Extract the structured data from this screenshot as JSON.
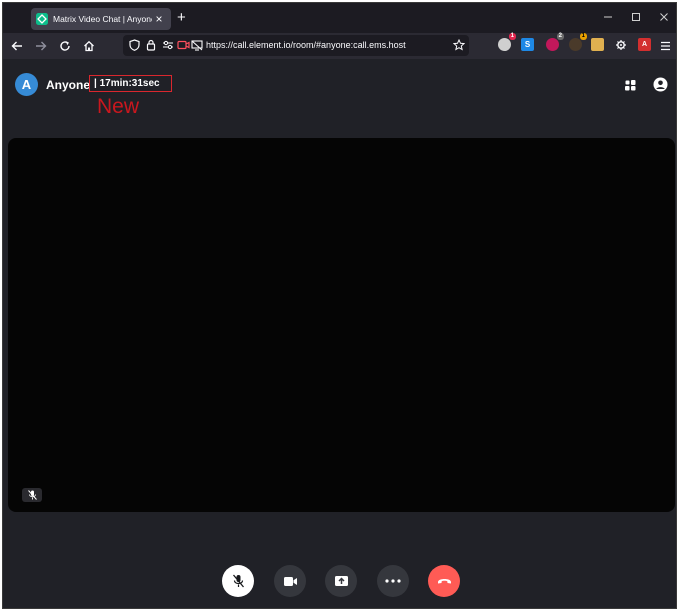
{
  "browser": {
    "tab": {
      "title": "Matrix Video Chat | Anyone",
      "favicon": "matrix-logo-icon"
    },
    "url": "https://call.element.io/room/#anyone:call.ems.host",
    "extensions": [
      {
        "name": "extension-1-icon",
        "badge": "1",
        "color": "#cfcfcf",
        "badge_color": "#e22850"
      },
      {
        "name": "skype-extension-icon",
        "badge": "",
        "color": "#1e88e5",
        "badge_color": ""
      },
      {
        "name": "extension-3-icon",
        "badge": "2",
        "color": "#c2185b",
        "badge_color": "#6b6b6b"
      },
      {
        "name": "extension-4-icon",
        "badge": "1",
        "color": "#4a3a2a",
        "badge_color": "#e8a000"
      },
      {
        "name": "extension-5-icon",
        "badge": "",
        "color": "#e0b050",
        "badge_color": ""
      },
      {
        "name": "puzzle-extension-icon",
        "badge": "",
        "color": "#cfcfcf",
        "badge_color": ""
      },
      {
        "name": "pdf-extension-icon",
        "badge": "",
        "color": "#d32f2f",
        "badge_color": ""
      }
    ]
  },
  "room": {
    "avatar_letter": "A",
    "name": "Anyone",
    "timer": "| 17min:31sec",
    "annotation": "New",
    "accent_color": "#368bd6"
  },
  "controls": {
    "mic": {
      "icon": "microphone-muted-icon",
      "state": "muted"
    },
    "camera": {
      "icon": "video-camera-icon"
    },
    "screenshare": {
      "icon": "screen-share-icon"
    },
    "more": {
      "icon": "more-options-icon"
    },
    "hangup": {
      "icon": "hang-up-icon",
      "color": "#ff5b55"
    }
  }
}
